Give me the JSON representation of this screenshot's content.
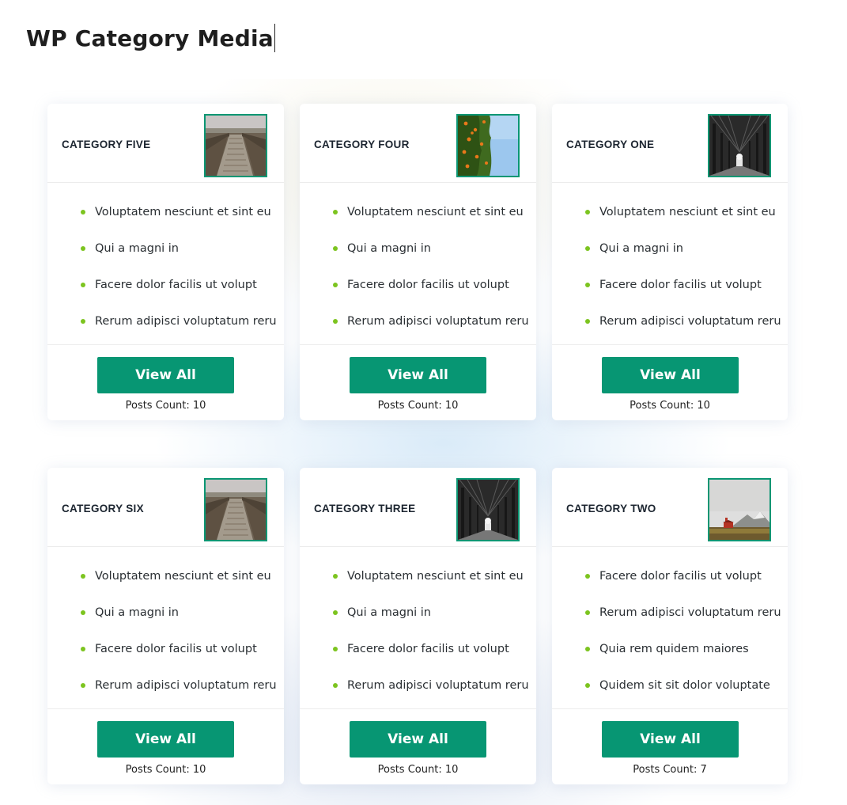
{
  "page": {
    "title": "WP Category Media"
  },
  "categories": [
    {
      "title": "CATEGORY FIVE",
      "image": "bridge-photo",
      "posts": [
        "Voluptatem nesciunt et sint eu",
        "Qui a magni in",
        "Facere dolor facilis ut volupt",
        "Rerum adipisci voluptatum reru"
      ],
      "button": "View All",
      "count": "Posts Count: 10"
    },
    {
      "title": "CATEGORY FOUR",
      "image": "orange-tree-photo",
      "posts": [
        "Voluptatem nesciunt et sint eu",
        "Qui a magni in",
        "Facere dolor facilis ut volupt",
        "Rerum adipisci voluptatum reru"
      ],
      "button": "View All",
      "count": "Posts Count: 10"
    },
    {
      "title": "CATEGORY ONE",
      "image": "tree-tunnel-photo",
      "posts": [
        "Voluptatem nesciunt et sint eu",
        "Qui a magni in",
        "Facere dolor facilis ut volupt",
        "Rerum adipisci voluptatum reru"
      ],
      "button": "View All",
      "count": "Posts Count: 10"
    },
    {
      "title": "CATEGORY SIX",
      "image": "bridge-photo",
      "posts": [
        "Voluptatem nesciunt et sint eu",
        "Qui a magni in",
        "Facere dolor facilis ut volupt",
        "Rerum adipisci voluptatum reru"
      ],
      "button": "View All",
      "count": "Posts Count: 10"
    },
    {
      "title": "CATEGORY THREE",
      "image": "tree-tunnel-photo",
      "posts": [
        "Voluptatem nesciunt et sint eu",
        "Qui a magni in",
        "Facere dolor facilis ut volupt",
        "Rerum adipisci voluptatum reru"
      ],
      "button": "View All",
      "count": "Posts Count: 10"
    },
    {
      "title": "CATEGORY TWO",
      "image": "church-landscape-photo",
      "posts": [
        "Facere dolor facilis ut volupt",
        "Rerum adipisci voluptatum reru",
        "Quia rem quidem maiores",
        "Quidem sit sit dolor voluptate"
      ],
      "button": "View All",
      "count": "Posts Count: 7"
    }
  ],
  "colors": {
    "accent": "#079673",
    "bullet": "#7cc41f",
    "thumb_border": "#0a9673"
  }
}
